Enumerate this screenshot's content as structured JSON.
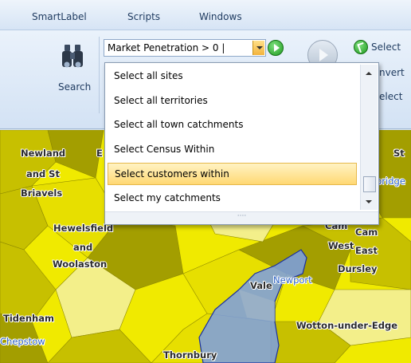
{
  "menubar": {
    "items": [
      "SmartLabel",
      "Scripts",
      "Windows"
    ]
  },
  "ribbon": {
    "search_label": "Search",
    "query_combo_value": "Market Penetration > 0 |",
    "select_label": "Select",
    "invert_label": "nvert",
    "select2_label": "elect"
  },
  "dropdown": {
    "items": [
      "Select all sites",
      "Select all territories",
      "Select all town catchments",
      "Select Census Within",
      "Select customers within",
      "Select my catchments"
    ],
    "selected_index": 4,
    "grip": "····"
  },
  "map": {
    "places": {
      "newland": "Newland",
      "and_st": "and St",
      "briavels": "Briavels",
      "e_frag": "E",
      "hewelsfield": "Hewelsfield",
      "and2": "and",
      "woolaston": "Woolaston",
      "cam1": "Cam",
      "cam2": "Cam",
      "west": "West",
      "east": "East",
      "dursley": "Dursley",
      "vale": "Vale",
      "newport": "Newport",
      "tidenham": "Tidenham",
      "wotton": "Wotton-under-Edge",
      "chepstow": "Chepstow",
      "thornbury": "Thornbury",
      "st_frag": "St",
      "bridge_frag": "bridge"
    },
    "colors": {
      "bright": "#f0ea00",
      "olive": "#c7c000",
      "dark_olive": "#a39e00",
      "pale": "#f3ef8a",
      "selection": "#7a9ee6"
    }
  }
}
